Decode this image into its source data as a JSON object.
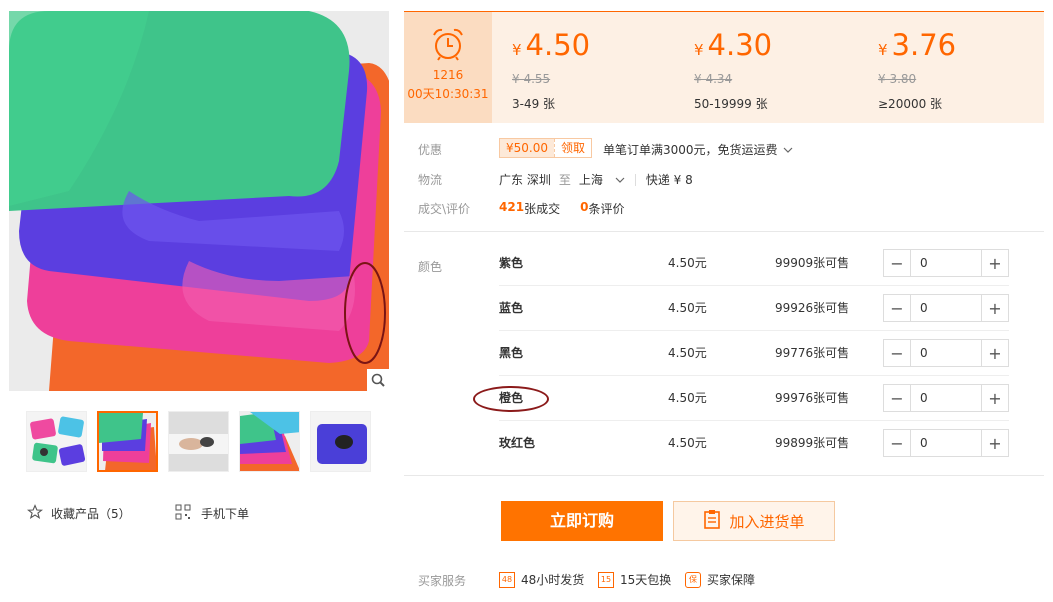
{
  "price": {
    "timer_date": "1216",
    "timer_countdown": "00天10:30:31",
    "currency": "¥",
    "tiers": [
      {
        "price": "4.50",
        "old": "¥ 4.55",
        "qty": "3-49 张"
      },
      {
        "price": "4.30",
        "old": "¥ 4.34",
        "qty": "50-19999 张"
      },
      {
        "price": "3.76",
        "old": "¥ 3.80",
        "qty": "≥20000 张"
      }
    ]
  },
  "promo": {
    "label": "优惠",
    "coupon_amount": "¥50.00",
    "coupon_action": "领取",
    "text": "单笔订单满3000元，免货运运费"
  },
  "logistics": {
    "label": "物流",
    "from": "广东 深圳",
    "to_word": "至",
    "to": "上海",
    "express": "快递 ¥ 8"
  },
  "deals": {
    "label": "成交\\评价",
    "count": "421",
    "count_text": "张成交",
    "reviews": "0",
    "reviews_text": "条评价"
  },
  "sku": {
    "label": "颜色",
    "rows": [
      {
        "name": "紫色",
        "price": "4.50元",
        "stock": "99909张可售",
        "qty": "0"
      },
      {
        "name": "蓝色",
        "price": "4.50元",
        "stock": "99926张可售",
        "qty": "0"
      },
      {
        "name": "黑色",
        "price": "4.50元",
        "stock": "99776张可售",
        "qty": "0"
      },
      {
        "name": "橙色",
        "price": "4.50元",
        "stock": "99976张可售",
        "qty": "0"
      },
      {
        "name": "玫红色",
        "price": "4.50元",
        "stock": "99899张可售",
        "qty": "0"
      }
    ]
  },
  "actions": {
    "order": "立即订购",
    "cart": "加入进货单"
  },
  "services": {
    "label": "买家服务",
    "items": [
      "48小时发货",
      "15天包换",
      "买家保障"
    ],
    "icons": [
      "48",
      "15",
      "保"
    ]
  },
  "left": {
    "favorite": "收藏产品（5）",
    "mobile": "手机下单"
  },
  "colors": {
    "accent": "#ff6600",
    "price_bg": "#fdf0e4"
  }
}
